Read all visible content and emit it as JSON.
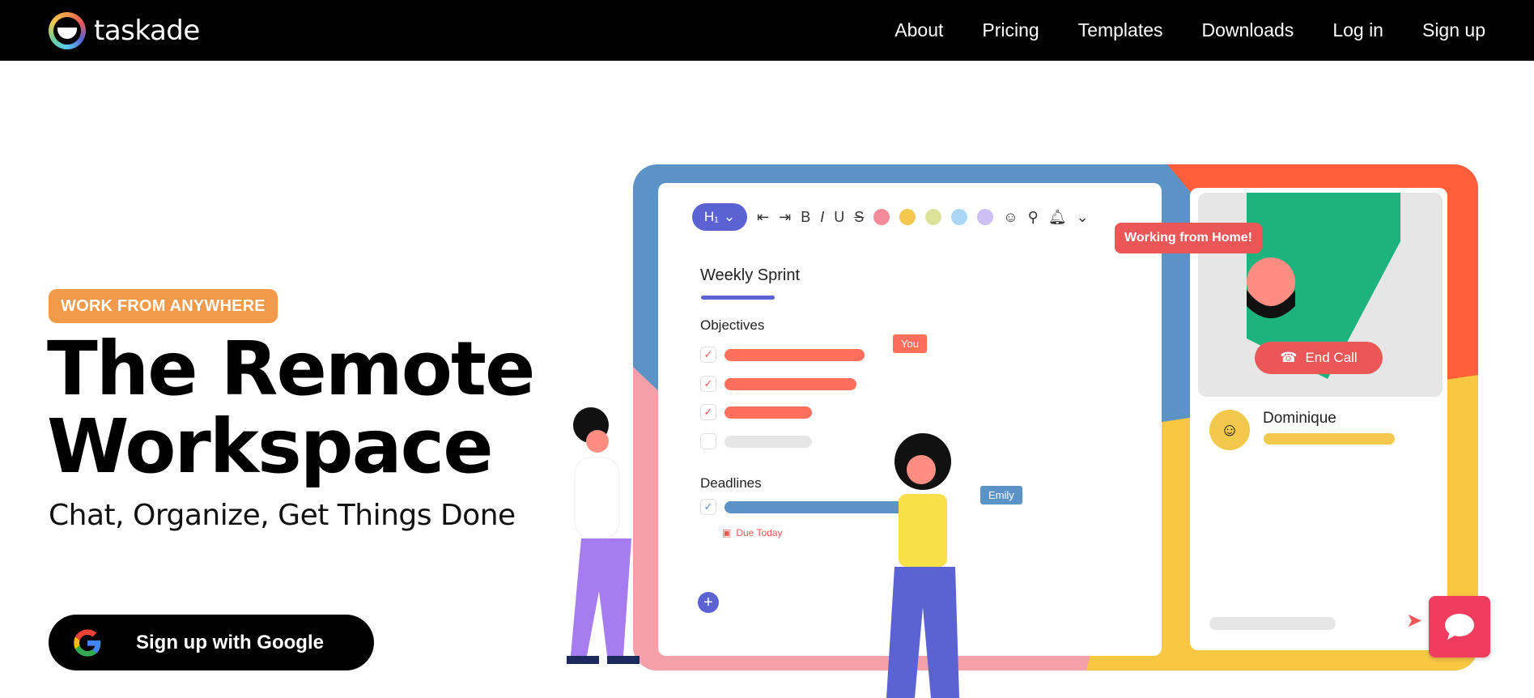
{
  "nav": {
    "logo_text": "taskade",
    "links": [
      "About",
      "Pricing",
      "Templates",
      "Downloads",
      "Log in",
      "Sign up"
    ]
  },
  "hero": {
    "badge": "WORK FROM ANYWHERE",
    "headline_line1": "The Remote",
    "headline_line2": "Workspace",
    "subhead": "Chat, Organize, Get Things Done",
    "cta": "Sign up with Google"
  },
  "illustration": {
    "toolbar": {
      "heading_pill": "H₁",
      "buttons": [
        "B",
        "I",
        "U",
        "S"
      ],
      "color_dots": [
        "#f38a9a",
        "#f2c94c",
        "#dbe39b",
        "#a9d7f3",
        "#cdbff2"
      ]
    },
    "doc": {
      "title": "Weekly Sprint",
      "section1": "Objectives",
      "tag_you": "You",
      "section2": "Deadlines",
      "tag_emily": "Emily",
      "due": "Due Today"
    },
    "bubble": "Working from Home!",
    "end_call": "End Call",
    "chat_name": "Dominique"
  },
  "colors": {
    "accent_orange": "#f2994a",
    "accent_red": "#eb5757",
    "accent_blue": "#5b63d3",
    "accent_yellow": "#f2c94c",
    "fab_pink": "#f03d5f"
  }
}
